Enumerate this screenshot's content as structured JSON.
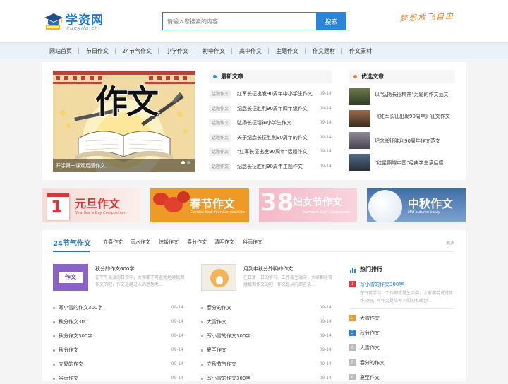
{
  "header": {
    "logo_text": "学资网",
    "logo_pinyin": "xuexila.cn",
    "search_placeholder": "请输入您搜索的内容",
    "search_button": "搜索",
    "slogan": "梦想放飞自由"
  },
  "nav": [
    "网站首页",
    "节日作文",
    "24节气作文",
    "小学作文",
    "初中作文",
    "高中作文",
    "主题作文",
    "作文题材",
    "作文素材"
  ],
  "slider": {
    "big_text": "作文",
    "caption": "开学第一课观后感作文"
  },
  "latest": {
    "title": "最新文章",
    "items": [
      {
        "tag": "话题作文",
        "title": "红军长征出发90周年中小学生作文",
        "date": "09-14"
      },
      {
        "tag": "话题作文",
        "title": "纪念长征胜利90周年四年级作文",
        "date": "09-14"
      },
      {
        "tag": "话题作文",
        "title": "弘扬长征精神小学生作文",
        "date": "09-14"
      },
      {
        "tag": "话题作文",
        "title": "关于纪念长征胜利90周年的作文",
        "date": "09-14"
      },
      {
        "tag": "话题作文",
        "title": "\"红军长征出发90周年\"话题作文",
        "date": "09-14"
      },
      {
        "tag": "话题作文",
        "title": "纪念长征胜利90周年主题作文",
        "date": "09-14"
      }
    ]
  },
  "picks": {
    "title": "优选文章",
    "items": [
      "以\"弘扬长征精神\"为题的作文范文",
      "《红军长征出发90周年》征文作文",
      "纪念长征胜利90周年作文范文",
      "\"红星照耀中国\"经典学生读后感"
    ]
  },
  "banners": [
    {
      "title": "元旦作文",
      "sub": "New Year's Day Composition",
      "badge": "1"
    },
    {
      "title": "春节作文",
      "sub": "Chinese New Year Composition"
    },
    {
      "title": "妇女节作文",
      "sub": "Women's Day Composition",
      "badge": "38"
    },
    {
      "title": "中秋作文",
      "sub": "Mid-autumn essay"
    }
  ],
  "jieqi": {
    "title": "24节气作文",
    "tabs": [
      "立春作文",
      "雨水作文",
      "惊蛰作文",
      "春分作文",
      "清明作文",
      "谷雨作文"
    ],
    "more": "更多",
    "featured": [
      {
        "thumb": "作文",
        "title": "秋分的作文600字",
        "summary": "在平平淡淡的日常中，大家都不可避免地接触到作文的吧，作文是经过人的思想考..."
      },
      {
        "title": "月到中秋分外明的作文",
        "summary": "在日复一日的学习、工作或生活中，大家都经常接触到作文的吧，作文是从内部言语..."
      }
    ],
    "list_left": [
      {
        "title": "写小雪的作文300字",
        "date": "09-14"
      },
      {
        "title": "秋分作文300",
        "date": "09-14"
      },
      {
        "title": "秋分作文300字",
        "date": "09-14"
      },
      {
        "title": "秋分作文",
        "date": "09-14"
      },
      {
        "title": "立夏的作文",
        "date": "09-14"
      },
      {
        "title": "谷雨作文",
        "date": "09-14"
      }
    ],
    "list_right": [
      {
        "title": "春分的作文",
        "date": "09-14"
      },
      {
        "title": "大雪作文",
        "date": "09-14"
      },
      {
        "title": "写小雪的作文300字",
        "date": "09-14"
      },
      {
        "title": "夏至作文",
        "date": "09-14"
      },
      {
        "title": "立秋节气作文",
        "date": "09-14"
      },
      {
        "title": "写小雪的作文300字",
        "date": "09-14"
      }
    ]
  },
  "hot": {
    "title": "热门排行",
    "first": "写小雪的作文300字",
    "first_desc": "在日常学习、工作抑或是生活中，大家都尝试过写作文吧，写作文是培养人们的推断力...",
    "items": [
      {
        "n": "2",
        "title": "大雪作文"
      },
      {
        "n": "3",
        "title": "秋分作文"
      },
      {
        "n": "4",
        "title": "大雪作文"
      },
      {
        "n": "5",
        "title": "春分的作文"
      },
      {
        "n": "6",
        "title": "夏至作文"
      }
    ]
  }
}
